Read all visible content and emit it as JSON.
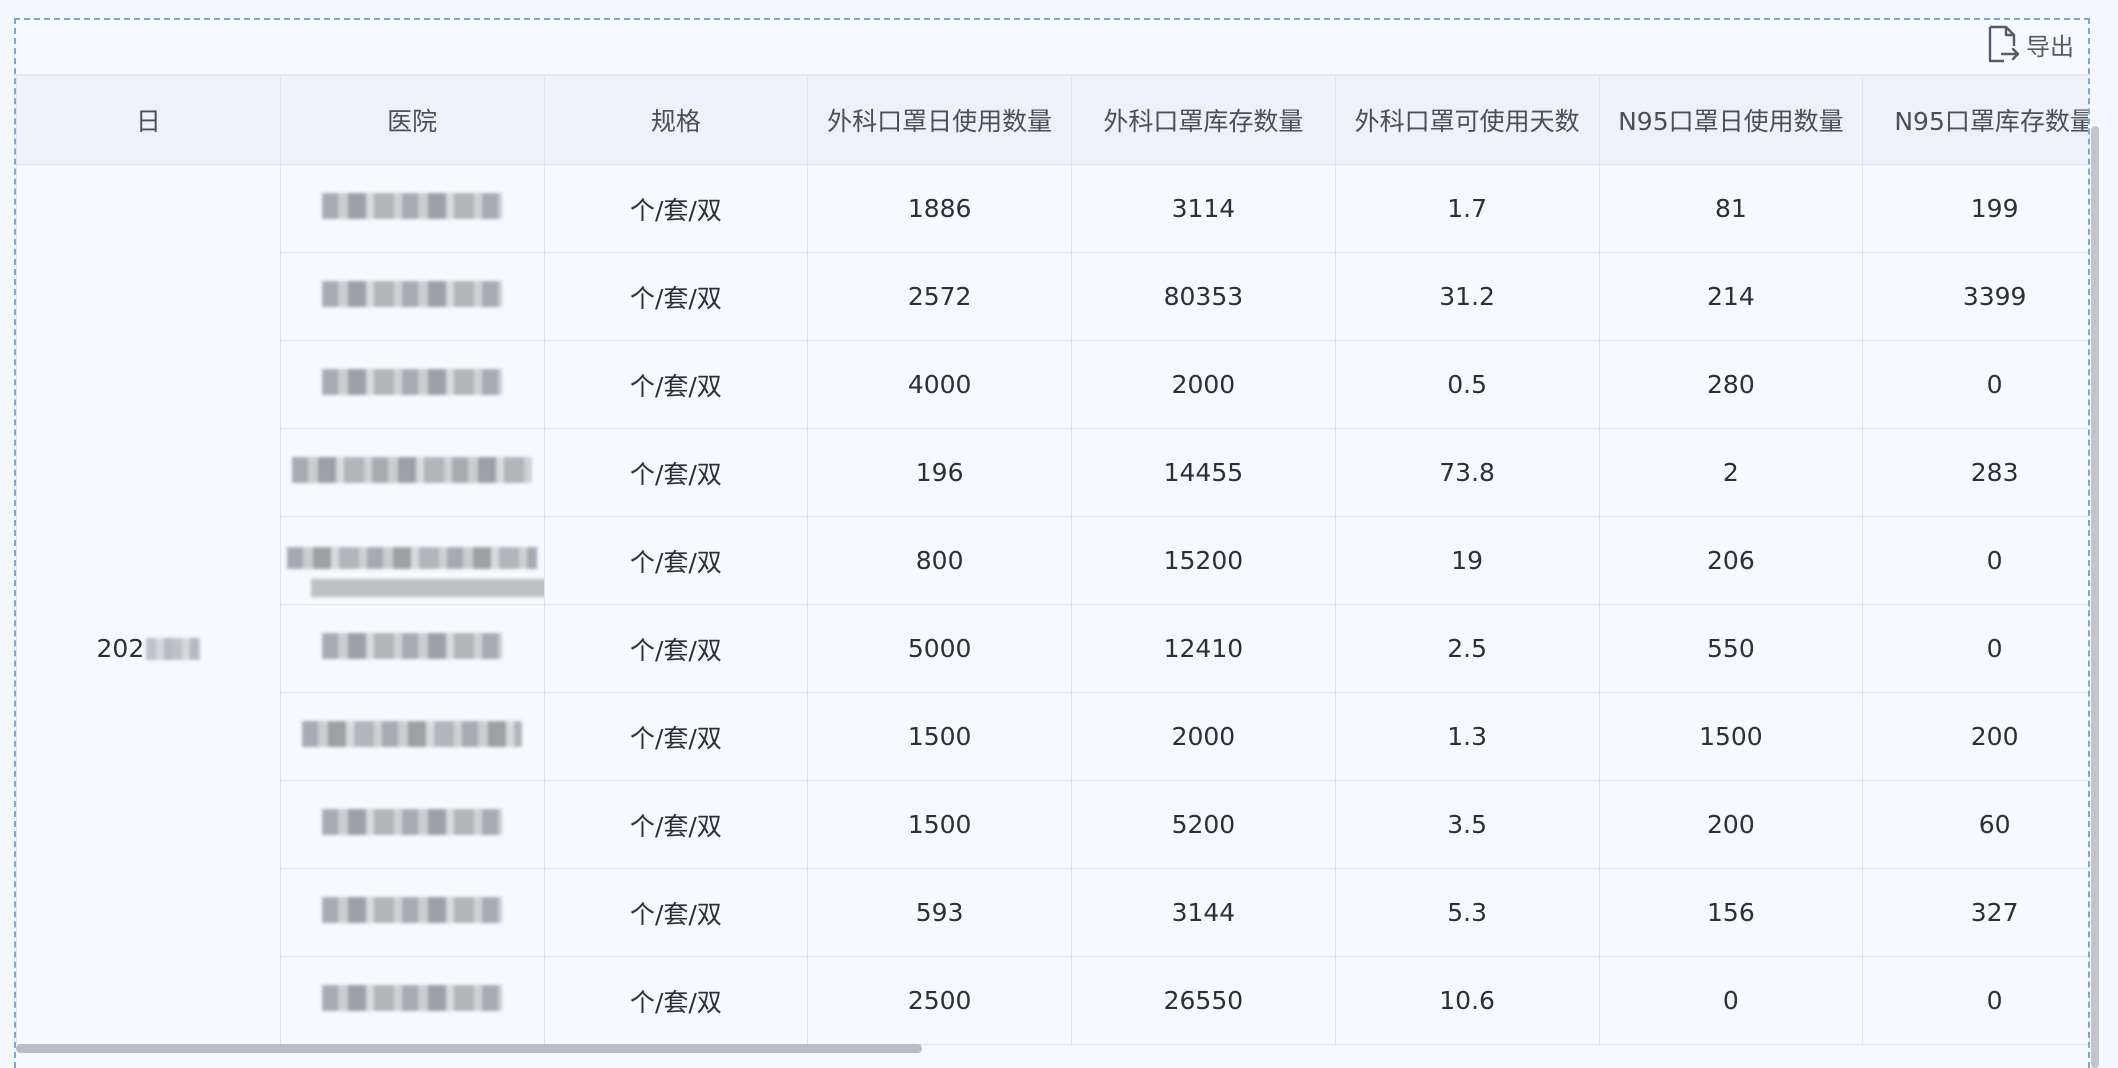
{
  "toolbar": {
    "export_label": "导出"
  },
  "table": {
    "headers": [
      "日",
      "医院",
      "规格",
      "外科口罩日使用数量",
      "外科口罩库存数量",
      "外科口罩可使用天数",
      "N95口罩日使用数量",
      "N95口罩库存数量"
    ],
    "date_prefix": "202",
    "spec": "个/套/双",
    "rows": [
      [
        "1886",
        "3114",
        "1.7",
        "81",
        "199"
      ],
      [
        "2572",
        "80353",
        "31.2",
        "214",
        "3399"
      ],
      [
        "4000",
        "2000",
        "0.5",
        "280",
        "0"
      ],
      [
        "196",
        "14455",
        "73.8",
        "2",
        "283"
      ],
      [
        "800",
        "15200",
        "19",
        "206",
        "0"
      ],
      [
        "5000",
        "12410",
        "2.5",
        "550",
        "0"
      ],
      [
        "1500",
        "2000",
        "1.3",
        "1500",
        "200"
      ],
      [
        "1500",
        "5200",
        "3.5",
        "200",
        "60"
      ],
      [
        "593",
        "3144",
        "5.3",
        "156",
        "327"
      ],
      [
        "2500",
        "26550",
        "10.6",
        "0",
        "0"
      ]
    ]
  },
  "icons": {
    "export": "export-file-icon"
  }
}
